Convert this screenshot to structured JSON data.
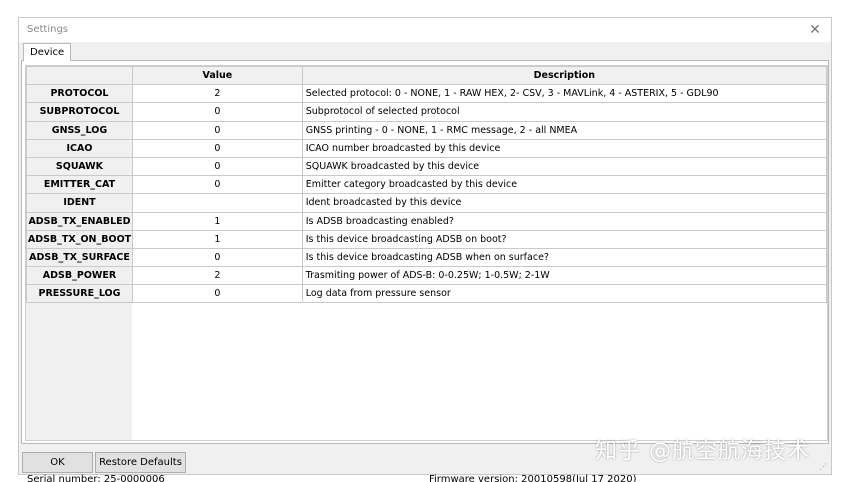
{
  "window": {
    "title": "Settings",
    "close_glyph": "✕"
  },
  "tabs": [
    {
      "label": "Device",
      "active": true
    }
  ],
  "table": {
    "columns": [
      "",
      "Value",
      "Description"
    ],
    "rows": [
      {
        "name": "PROTOCOL",
        "value": "2",
        "description": "Selected protocol: 0 - NONE, 1 - RAW HEX, 2- CSV, 3 - MAVLink, 4 - ASTERIX, 5 - GDL90"
      },
      {
        "name": "SUBPROTOCOL",
        "value": "0",
        "description": "Subprotocol of selected protocol"
      },
      {
        "name": "GNSS_LOG",
        "value": "0",
        "description": "GNSS printing - 0 - NONE, 1 - RMC message, 2 - all NMEA"
      },
      {
        "name": "ICAO",
        "value": "0",
        "description": "ICAO number broadcasted by this device"
      },
      {
        "name": "SQUAWK",
        "value": "0",
        "description": "SQUAWK broadcasted by this device"
      },
      {
        "name": "EMITTER_CAT",
        "value": "0",
        "description": "Emitter category broadcasted by this device"
      },
      {
        "name": "IDENT",
        "value": "",
        "description": "Ident broadcasted by this device"
      },
      {
        "name": "ADSB_TX_ENABLED",
        "value": "1",
        "description": "Is ADSB broadcasting enabled?"
      },
      {
        "name": "ADSB_TX_ON_BOOT",
        "value": "1",
        "description": "Is this device broadcasting ADSB on boot?"
      },
      {
        "name": "ADSB_TX_SURFACE",
        "value": "0",
        "description": "Is this device broadcasting ADSB when on surface?"
      },
      {
        "name": "ADSB_POWER",
        "value": "2",
        "description": "Trasmiting power of ADS-B: 0-0.25W; 1-0.5W; 2-1W"
      },
      {
        "name": "PRESSURE_LOG",
        "value": "0",
        "description": "Log data from pressure sensor"
      }
    ]
  },
  "status": {
    "serial": "Serial number: 25-0000006",
    "firmware": "Firmware version: 20010598(Jul 17 2020)"
  },
  "buttons": {
    "ok": "OK",
    "restore": "Restore Defaults"
  },
  "watermark": "知乎 @航空航海技术",
  "icons": {
    "close": "close-icon",
    "resize_grip": "resize-grip-icon"
  },
  "colors": {
    "window_bg": "#f0f0f0",
    "header_bg": "#f0f0f0",
    "grid_line": "#c9c9c9"
  }
}
